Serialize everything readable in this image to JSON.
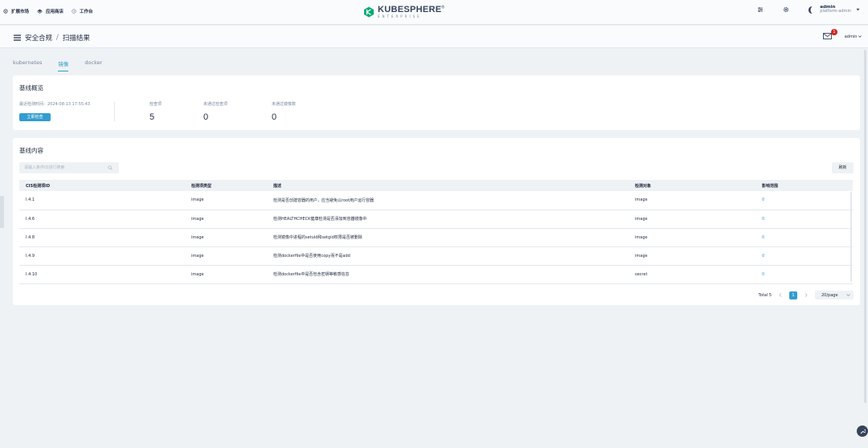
{
  "topbar": {
    "nav": [
      {
        "label": "扩展市场",
        "icon": "extensions-icon"
      },
      {
        "label": "应用商店",
        "icon": "app-store-icon"
      },
      {
        "label": "工作台",
        "icon": "workbench-icon"
      }
    ],
    "logo": {
      "brand": "KUBESPHERE",
      "reg": "®",
      "sub": "ENTERPRISE"
    },
    "user": {
      "name": "admin",
      "role": "platform-admin"
    }
  },
  "subbar": {
    "breadcrumb": [
      "安全合规",
      "扫描结果"
    ],
    "separator": "/",
    "notification_count": "1",
    "user": "admin"
  },
  "tabs": [
    {
      "label": "kubernetes",
      "active": false
    },
    {
      "label": "镜像",
      "active": true
    },
    {
      "label": "docker",
      "active": false
    }
  ],
  "overview": {
    "title": "基线概览",
    "last_scan": "最近检测时间：2024-08-13 17:55:43",
    "scan_button": "立即检查",
    "stats": [
      {
        "label": "检查项",
        "value": "5"
      },
      {
        "label": "未通过检查项",
        "value": "0"
      },
      {
        "label": "未通过镜像数",
        "value": "0"
      }
    ]
  },
  "content": {
    "title": "基线内容",
    "search_placeholder": "请输入条件ID进行搜索",
    "refresh_label": "刷新",
    "columns": [
      "CIS检测项ID",
      "检测项类型",
      "描述",
      "检测对象",
      "影响范围"
    ],
    "rows": [
      {
        "id": "I.4.1",
        "type": "image",
        "desc": "检测是否创建容器的用户，应当避免以root用户运行容器",
        "target": "image",
        "scope": "0"
      },
      {
        "id": "I.4.6",
        "type": "image",
        "desc": "检测HEALTHCHECK健康检测是否添加到容器镜像中",
        "target": "image",
        "scope": "0"
      },
      {
        "id": "I.4.8",
        "type": "image",
        "desc": "检测镜像中进程的setuid和setgid权限是否被删除",
        "target": "image",
        "scope": "0"
      },
      {
        "id": "I.4.9",
        "type": "image",
        "desc": "检测dockerfile中是否使用copy而不是add",
        "target": "image",
        "scope": "0"
      },
      {
        "id": "I.4.10",
        "type": "image",
        "desc": "检测dockerfile中是否包含密钥等敏感信息",
        "target": "secret",
        "scope": "0"
      }
    ],
    "pagination": {
      "total": "Total 5",
      "current": "1",
      "page_size": "20/page"
    }
  },
  "colors": {
    "accent": "#329dce",
    "text": "#242e42",
    "muted": "#79879c",
    "background": "#eff2f5",
    "badge": "#ca2621"
  }
}
